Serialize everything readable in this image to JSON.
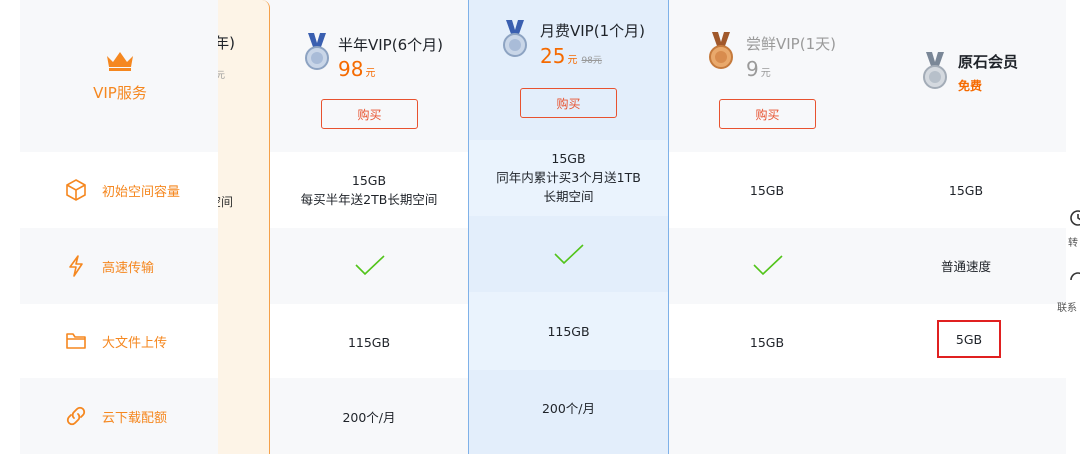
{
  "feature_column": {
    "header": "VIP服务",
    "rows": [
      {
        "label": "初始空间容量",
        "icon": "cube-icon"
      },
      {
        "label": "高速传输",
        "icon": "lightning-icon"
      },
      {
        "label": "大文件上传",
        "icon": "folder-icon"
      },
      {
        "label": "云下载配额",
        "icon": "link-icon"
      }
    ]
  },
  "year_plan_partial": {
    "title_fragment": "年)",
    "sub_fragment": "元",
    "storage_fragment": "空间"
  },
  "plans": [
    {
      "key": "half_year",
      "title": "半年VIP(6个月)",
      "price": "98",
      "unit": "元",
      "buy": "购买",
      "medal": "silver-medal-icon"
    },
    {
      "key": "month",
      "title": "月费VIP(1个月)",
      "price": "25",
      "unit": "元",
      "original_price": "98元",
      "buy": "购买",
      "medal": "silver-medal-icon"
    },
    {
      "key": "trial",
      "title": "尝鲜VIP(1天)",
      "price": "9",
      "unit": "元",
      "buy": "购买",
      "medal": "bronze-medal-icon"
    },
    {
      "key": "basic",
      "title": "原石会员",
      "price_label": "免费",
      "medal": "gray-medal-icon"
    }
  ],
  "cells": {
    "half_year": {
      "storage_line1": "15GB",
      "storage_line2": "每买半年送2TB长期空间",
      "upload": "115GB",
      "cloud_download": "200个/月"
    },
    "month": {
      "storage_line1": "15GB",
      "storage_line2": "同年内累计买3个月送1TB",
      "storage_line3": "长期空间",
      "upload": "115GB",
      "cloud_download": "200个/月"
    },
    "trial": {
      "storage": "15GB",
      "upload": "15GB"
    },
    "basic": {
      "storage": "15GB",
      "speed": "普通速度",
      "upload": "5GB"
    }
  },
  "side_toolbar": {
    "item1_fragment": "转",
    "item2_fragment": "联系"
  },
  "colors": {
    "accent_orange": "#f5871f",
    "buy_red": "#e8522f",
    "price_orange": "#f56a00",
    "check_green": "#52c41a",
    "highlight_red": "#e02020"
  }
}
